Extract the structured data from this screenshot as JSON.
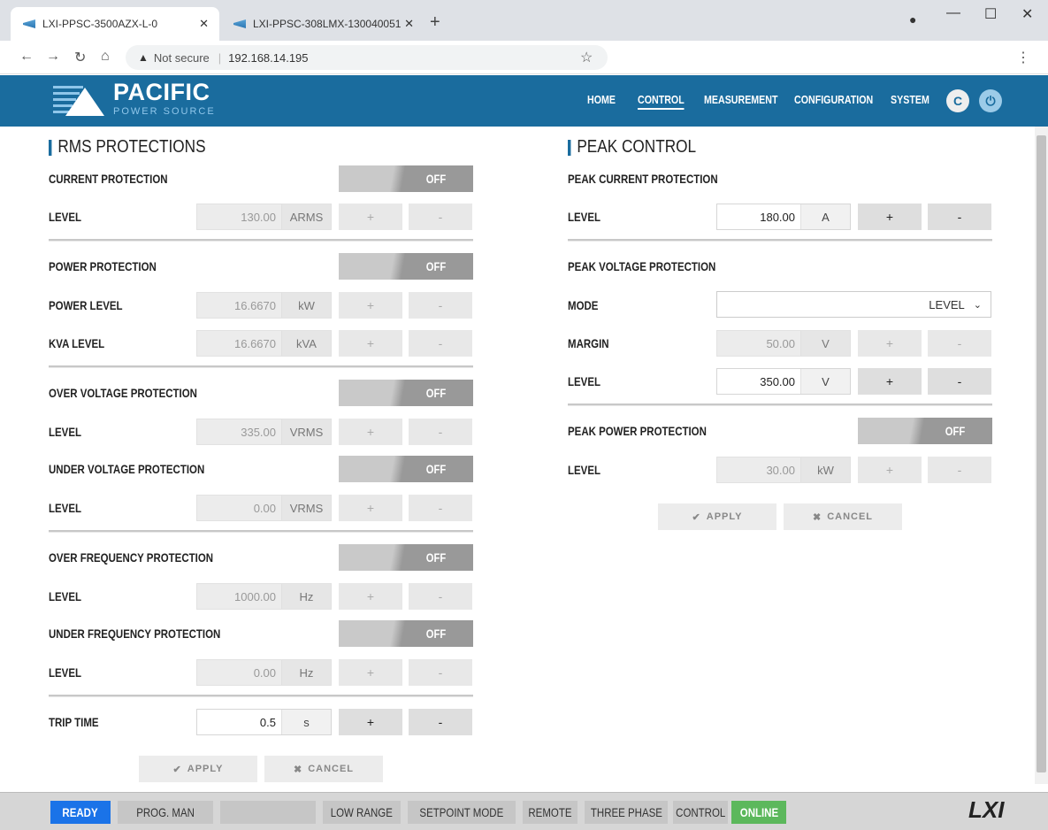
{
  "browser": {
    "tabs": [
      {
        "title": "LXI-PPSC-3500AZX-L-0"
      },
      {
        "title": "LXI-PPSC-308LMX-130040051"
      }
    ],
    "security": "Not secure",
    "url": "192.168.14.195"
  },
  "brand": {
    "name": "PACIFIC",
    "sub": "POWER SOURCE"
  },
  "nav": {
    "home": "HOME",
    "control": "CONTROL",
    "measurement": "MEASUREMENT",
    "configuration": "CONFIGURATION",
    "system": "SYSTEM"
  },
  "rms": {
    "title": "RMS PROTECTIONS",
    "current": {
      "label": "CURRENT PROTECTION",
      "state": "OFF",
      "level_label": "LEVEL",
      "level": "130.00",
      "unit": "ARMS"
    },
    "power": {
      "label": "POWER PROTECTION",
      "state": "OFF",
      "power_label": "POWER LEVEL",
      "power": "16.6670",
      "power_unit": "kW",
      "kva_label": "KVA LEVEL",
      "kva": "16.6670",
      "kva_unit": "kVA"
    },
    "over_voltage": {
      "label": "OVER VOLTAGE PROTECTION",
      "state": "OFF",
      "level_label": "LEVEL",
      "level": "335.00",
      "unit": "VRMS"
    },
    "under_voltage": {
      "label": "UNDER VOLTAGE PROTECTION",
      "state": "OFF",
      "level_label": "LEVEL",
      "level": "0.00",
      "unit": "VRMS"
    },
    "over_freq": {
      "label": "OVER FREQUENCY PROTECTION",
      "state": "OFF",
      "level_label": "LEVEL",
      "level": "1000.00",
      "unit": "Hz"
    },
    "under_freq": {
      "label": "UNDER FREQUENCY PROTECTION",
      "state": "OFF",
      "level_label": "LEVEL",
      "level": "0.00",
      "unit": "Hz"
    },
    "trip": {
      "label": "TRIP TIME",
      "value": "0.5",
      "unit": "s"
    },
    "apply": "APPLY",
    "cancel": "CANCEL"
  },
  "peak": {
    "title": "PEAK CONTROL",
    "current": {
      "label": "PEAK CURRENT PROTECTION",
      "level_label": "LEVEL",
      "level": "180.00",
      "unit": "A"
    },
    "voltage": {
      "label": "PEAK VOLTAGE PROTECTION",
      "mode_label": "MODE",
      "mode": "LEVEL",
      "margin_label": "MARGIN",
      "margin": "50.00",
      "margin_unit": "V",
      "level_label": "LEVEL",
      "level": "350.00",
      "level_unit": "V"
    },
    "power": {
      "label": "PEAK POWER PROTECTION",
      "state": "OFF",
      "level_label": "LEVEL",
      "level": "30.00",
      "unit": "kW"
    },
    "apply": "APPLY",
    "cancel": "CANCEL"
  },
  "common": {
    "plus": "+",
    "minus": "-"
  },
  "status": {
    "ready": "READY",
    "prog": "PROG. MAN",
    "range": "LOW RANGE",
    "setpoint": "SETPOINT MODE",
    "remote": "REMOTE",
    "phase": "THREE PHASE",
    "control": "CONTROL",
    "online": "ONLINE",
    "lxi": "LXI"
  }
}
